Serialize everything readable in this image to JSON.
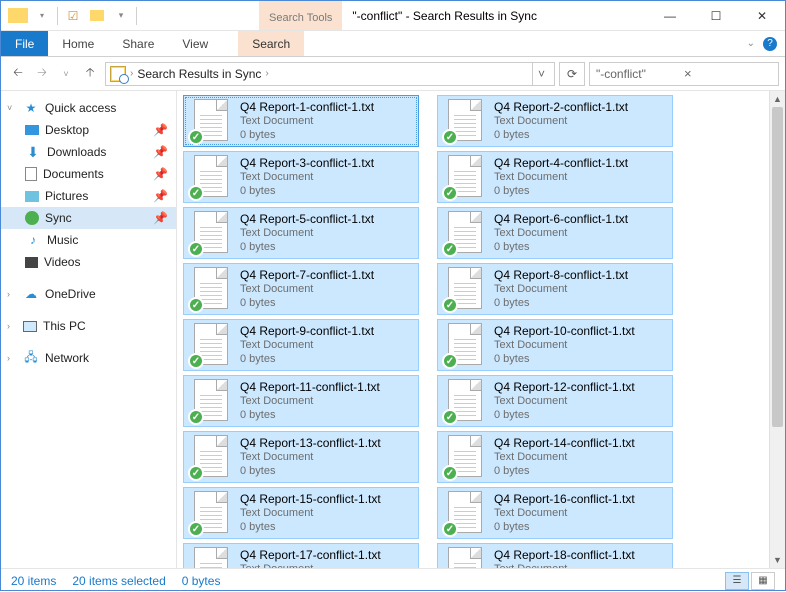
{
  "window": {
    "title": "\"-conflict\" - Search Results in Sync",
    "search_tools_tab": "Search Tools"
  },
  "ribbon": {
    "file": "File",
    "home": "Home",
    "share": "Share",
    "view": "View",
    "search": "Search"
  },
  "nav": {
    "breadcrumb": "Search Results in Sync",
    "search_value": "\"-conflict\""
  },
  "sidebar": {
    "quick_access": "Quick access",
    "items": [
      {
        "label": "Desktop",
        "pinned": true
      },
      {
        "label": "Downloads",
        "pinned": true
      },
      {
        "label": "Documents",
        "pinned": true
      },
      {
        "label": "Pictures",
        "pinned": true
      },
      {
        "label": "Sync",
        "pinned": true
      },
      {
        "label": "Music",
        "pinned": false
      },
      {
        "label": "Videos",
        "pinned": false
      }
    ],
    "onedrive": "OneDrive",
    "this_pc": "This PC",
    "network": "Network"
  },
  "files": {
    "type_label": "Text Document",
    "size_label": "0 bytes",
    "items": [
      {
        "name": "Q4 Report-1-conflict-1.txt"
      },
      {
        "name": "Q4 Report-2-conflict-1.txt"
      },
      {
        "name": "Q4 Report-3-conflict-1.txt"
      },
      {
        "name": "Q4 Report-4-conflict-1.txt"
      },
      {
        "name": "Q4 Report-5-conflict-1.txt"
      },
      {
        "name": "Q4 Report-6-conflict-1.txt"
      },
      {
        "name": "Q4 Report-7-conflict-1.txt"
      },
      {
        "name": "Q4 Report-8-conflict-1.txt"
      },
      {
        "name": "Q4 Report-9-conflict-1.txt"
      },
      {
        "name": "Q4 Report-10-conflict-1.txt"
      },
      {
        "name": "Q4 Report-11-conflict-1.txt"
      },
      {
        "name": "Q4 Report-12-conflict-1.txt"
      },
      {
        "name": "Q4 Report-13-conflict-1.txt"
      },
      {
        "name": "Q4 Report-14-conflict-1.txt"
      },
      {
        "name": "Q4 Report-15-conflict-1.txt"
      },
      {
        "name": "Q4 Report-16-conflict-1.txt"
      },
      {
        "name": "Q4 Report-17-conflict-1.txt"
      },
      {
        "name": "Q4 Report-18-conflict-1.txt"
      }
    ]
  },
  "status": {
    "count": "20 items",
    "selected": "20 items selected",
    "size": "0 bytes"
  }
}
